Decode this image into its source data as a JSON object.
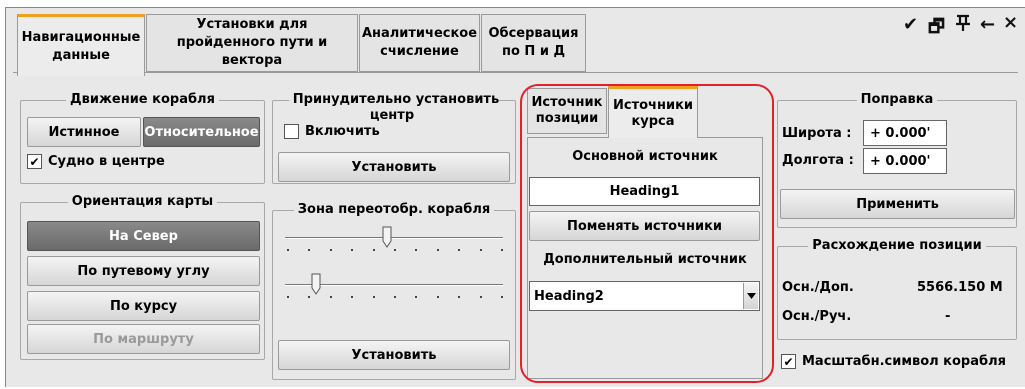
{
  "tabs": [
    {
      "line1": "Навигационные",
      "line2": "данные",
      "active": true
    },
    {
      "line1": "Установки для",
      "line2": "пройденного пути и вектора"
    },
    {
      "line1": "Аналитическое",
      "line2": "счисление"
    },
    {
      "line1": "Обсервация",
      "line2": "по П и Д"
    }
  ],
  "window_controls": {
    "pin": "✔",
    "restore": "🗗",
    "dock": "Д",
    "back": "←",
    "close": "×"
  },
  "ship_motion": {
    "title": "Движение корабля",
    "true_label": "Истинное",
    "relative_label": "Относительное",
    "center_label": "Судно в центре",
    "center_checked": "✔"
  },
  "map_orientation": {
    "title": "Ориентация карты",
    "north": "На Север",
    "track_angle": "По путевому углу",
    "course": "По курсу",
    "route": "По маршруту"
  },
  "force_center": {
    "title": "Принудительно установить центр",
    "enable_label": "Включить",
    "set_label": "Установить"
  },
  "redisplay_zone": {
    "title": "Зона переотобр. корабля",
    "slider1_value": 0.47,
    "slider2_value": 0.14,
    "set_label": "Установить"
  },
  "source_tabs": [
    {
      "line1": "Источник",
      "line2": "позиции"
    },
    {
      "line1": "Источники",
      "line2": "курса",
      "active": true
    }
  ],
  "heading_sources": {
    "main_label": "Основной источник",
    "main_value": "Heading1",
    "swap_label": "Поменять источники",
    "secondary_label": "Дополнительный источник",
    "secondary_value": "Heading2"
  },
  "correction": {
    "title": "Поправка",
    "lat_label": "Широта :",
    "lat_value": "+ 0.000'",
    "lon_label": "Долгота :",
    "lon_value": "+ 0.000'",
    "apply_label": "Применить"
  },
  "position_divergence": {
    "title": "Расхождение позиции",
    "row1_label": "Осн./Доп.",
    "row1_value": "5566.150 М",
    "row2_label": "Осн./Руч.",
    "row2_value": "-"
  },
  "scale_symbol": {
    "label": "Масштабн.символ корабля",
    "checked": "✔"
  }
}
